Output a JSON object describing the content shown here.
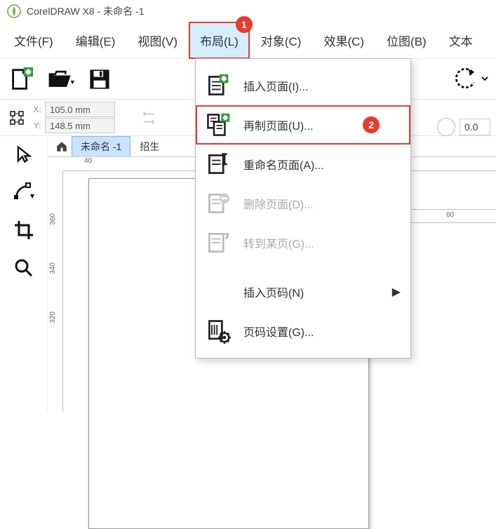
{
  "app": {
    "title": "CorelDRAW X8 - 未命名 -1"
  },
  "menubar": {
    "file": "文件(F)",
    "edit": "编辑(E)",
    "view": "视图(V)",
    "layout": "布局(L)",
    "object": "对象(C)",
    "effect": "效果(C)",
    "bitmap": "位图(B)",
    "text": "文本"
  },
  "annotations": {
    "badge_menu": "1",
    "badge_row": "2"
  },
  "propbar": {
    "x_label": "X:",
    "y_label": "Y:",
    "x": "105.0 mm",
    "y": "148.5 mm",
    "right_value": "0.0"
  },
  "tabs": {
    "active": "未命名 -1",
    "second": "招生"
  },
  "ruler": {
    "h1": "40",
    "h2": "60"
  },
  "vticks": [
    "360",
    "340",
    "320"
  ],
  "dropdown": {
    "insert_page": "插入页面(I)...",
    "duplicate_page": "再制页面(U)...",
    "rename_page": "重命名页面(A)...",
    "delete_page": "删除页面(D)...",
    "goto_page": "转到某页(G)...",
    "insert_pagenum": "插入页码(N)",
    "page_setup": "页码设置(G)..."
  }
}
